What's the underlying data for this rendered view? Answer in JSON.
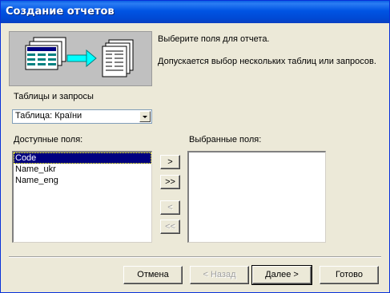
{
  "window": {
    "title": "Создание отчетов"
  },
  "hint": {
    "line1": "Выберите поля для отчета.",
    "line2": "Допускается выбор нескольких таблиц или запросов."
  },
  "tables": {
    "label": "Таблицы и запросы",
    "selected": "Таблица: Країни"
  },
  "available": {
    "label": "Доступные поля:",
    "items": [
      "Code",
      "Name_ukr",
      "Name_eng"
    ],
    "selected_index": 0
  },
  "selected_fields": {
    "label": "Выбранные поля:",
    "items": []
  },
  "move_buttons": {
    "add_one": ">",
    "add_all": ">>",
    "remove_one": "<",
    "remove_all": "<<"
  },
  "footer": {
    "cancel": "Отмена",
    "back": "< Назад",
    "next": "Далее >",
    "finish": "Готово"
  }
}
